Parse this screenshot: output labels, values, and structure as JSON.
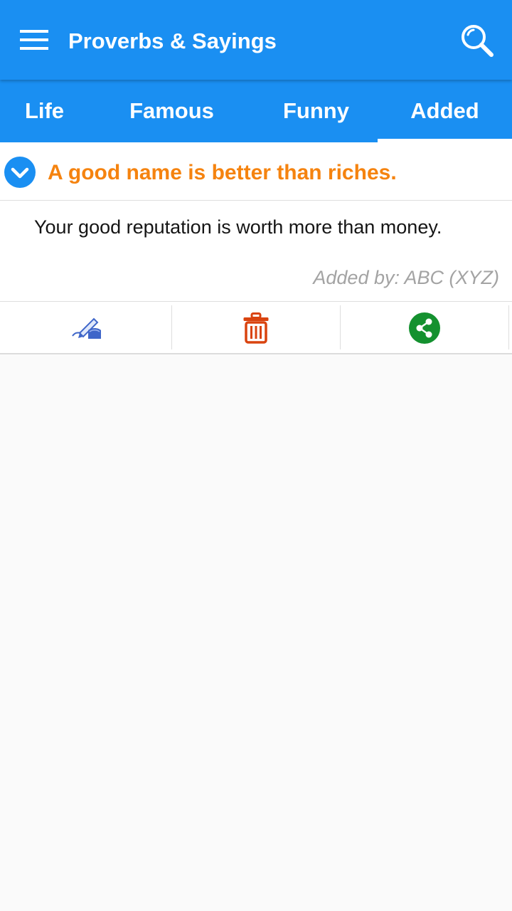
{
  "app_bar": {
    "title": "Proverbs & Sayings",
    "menu_icon": "hamburger-menu-icon",
    "search_icon": "search-icon",
    "background_color": "#1a8ff2"
  },
  "tabs": [
    {
      "label": "Life",
      "active": false
    },
    {
      "label": "Famous",
      "active": false
    },
    {
      "label": "Funny",
      "active": false
    },
    {
      "label": "Added",
      "active": true
    }
  ],
  "proverb": {
    "title": "A good name is better than riches.",
    "meaning": "Your good reputation is worth more than money.",
    "added_by": "Added by: ABC (XYZ)",
    "title_color": "#f5830f",
    "expand_icon": "chevron-down-circle-icon"
  },
  "actions": [
    {
      "name": "edit",
      "icon": "pen-writing-icon",
      "color": "#3f66c9"
    },
    {
      "name": "delete",
      "icon": "trash-icon",
      "color": "#d9430f"
    },
    {
      "name": "share",
      "icon": "share-icon",
      "color": "#14912f"
    }
  ]
}
